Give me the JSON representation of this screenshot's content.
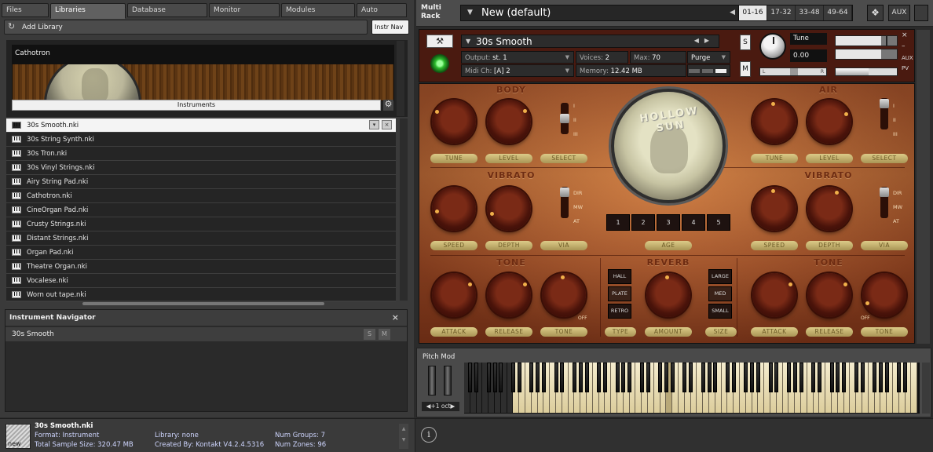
{
  "browser": {
    "tabs": [
      "Files",
      "Libraries",
      "Database",
      "Monitor",
      "Modules",
      "Auto"
    ],
    "active_tab": "Libraries",
    "add_library": "Add Library",
    "instr_nav": "Instr Nav",
    "library_name": "Cathotron",
    "library_instruments_label": "Instruments",
    "files": [
      "30s Smooth.nki",
      "30s String Synth.nki",
      "30s Tron.nki",
      "30s Vinyl Strings.nki",
      "Airy String Pad.nki",
      "Cathotron.nki",
      "CineOrgan Pad.nki",
      "Crusty Strings.nki",
      "Distant Strings.nki",
      "Organ Pad.nki",
      "Theatre Organ.nki",
      "Vocalese.nki",
      "Worn out tape.nki"
    ],
    "selected_file": "30s Smooth.nki"
  },
  "navigator": {
    "title": "Instrument Navigator",
    "instrument": "30s Smooth",
    "s_label": "S",
    "m_label": "M"
  },
  "rack": {
    "label_line1": "Multi",
    "label_line2": "Rack",
    "preset": "New (default)",
    "page_tabs": [
      "01-16",
      "17-32",
      "33-48",
      "49-64"
    ],
    "active_page": "01-16",
    "aux": "AUX"
  },
  "instrument": {
    "name": "30s Smooth",
    "output_label": "Output:",
    "output_value": "st. 1",
    "voices_label": "Voices:",
    "voices_value": "2",
    "max_label": "Max:",
    "max_value": "70",
    "purge": "Purge",
    "midi_label": "Midi Ch:",
    "midi_value": "[A]  2",
    "memory_label": "Memory:",
    "memory_value": "12.42 MB",
    "s": "S",
    "m": "M",
    "tune_label": "Tune",
    "tune_value": "0.00",
    "pan_l": "L",
    "pan_r": "R",
    "aux_small": "AUX",
    "pv_small": "PV"
  },
  "panel": {
    "body_title": "BODY",
    "air_title": "AIR",
    "vibrato_title": "VIBRATO",
    "tone_title": "TONE",
    "reverb_title": "REVERB",
    "disc_text": "HOLLOW SUN",
    "plates": {
      "tune": "TUNE",
      "level": "LEVEL",
      "select": "SELECT",
      "speed": "SPEED",
      "depth": "DEPTH",
      "via": "VIA",
      "age": "AGE",
      "attack": "ATTACK",
      "release": "RELEASE",
      "tone": "TONE",
      "type": "TYPE",
      "amount": "AMOUNT",
      "size": "SIZE"
    },
    "switch_labels_body": [
      "I",
      "II",
      "III"
    ],
    "switch_labels_vib": [
      "DIR",
      "MW",
      "AT"
    ],
    "age_buttons": [
      "1",
      "2",
      "3",
      "4",
      "5"
    ],
    "reverb_types": [
      "HALL",
      "PLATE",
      "RETRO"
    ],
    "reverb_sizes": [
      "LARGE",
      "MED",
      "SMALL"
    ],
    "off": "OFF"
  },
  "keyboard": {
    "pitch_mod": "Pitch Mod",
    "octave": "+1 oct"
  },
  "status": {
    "thumb_label": "new",
    "file": "30s Smooth.nki",
    "format": "Format: Instrument",
    "size": "Total Sample Size: 320.47 MB",
    "library": "Library: none",
    "created": "Created By: Kontakt V4.2.4.5316",
    "groups": "Num Groups: 7",
    "zones": "Num Zones: 96",
    "info_icon": "i"
  }
}
